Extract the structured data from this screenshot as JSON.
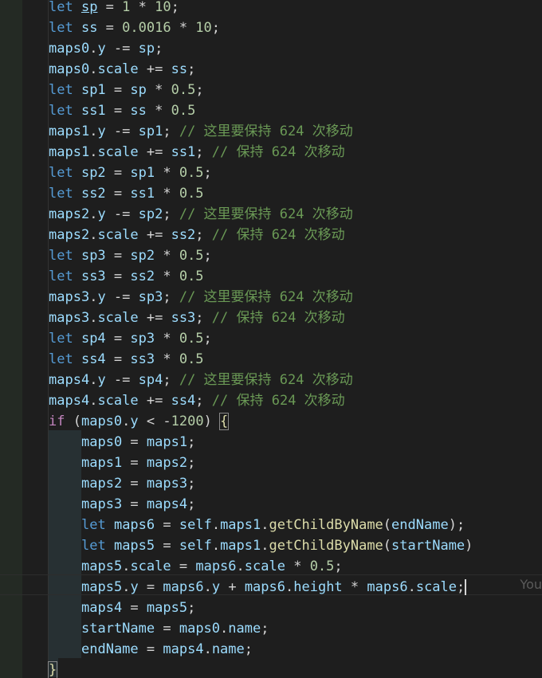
{
  "editor": {
    "ghost_text": "You",
    "lines": [
      {
        "tokens": [
          [
            "kw",
            "let "
          ],
          [
            "id_ul",
            "sp"
          ],
          [
            "op",
            " = "
          ],
          [
            "num",
            "1"
          ],
          [
            "op",
            " * "
          ],
          [
            "num",
            "10"
          ],
          [
            "op",
            ";"
          ]
        ]
      },
      {
        "tokens": [
          [
            "kw",
            "let "
          ],
          [
            "id",
            "ss"
          ],
          [
            "op",
            " = "
          ],
          [
            "num",
            "0.0016"
          ],
          [
            "op",
            " * "
          ],
          [
            "num",
            "10"
          ],
          [
            "op",
            ";"
          ]
        ]
      },
      {
        "tokens": [
          [
            "id",
            "maps0"
          ],
          [
            "op",
            "."
          ],
          [
            "id",
            "y"
          ],
          [
            "op",
            " -= "
          ],
          [
            "id",
            "sp"
          ],
          [
            "op",
            ";"
          ]
        ]
      },
      {
        "tokens": [
          [
            "id",
            "maps0"
          ],
          [
            "op",
            "."
          ],
          [
            "id",
            "scale"
          ],
          [
            "op",
            " += "
          ],
          [
            "id",
            "ss"
          ],
          [
            "op",
            ";"
          ]
        ]
      },
      {
        "tokens": [
          [
            "kw",
            "let "
          ],
          [
            "id",
            "sp1"
          ],
          [
            "op",
            " = "
          ],
          [
            "id",
            "sp"
          ],
          [
            "op",
            " * "
          ],
          [
            "num",
            "0.5"
          ],
          [
            "op",
            ";"
          ]
        ]
      },
      {
        "tokens": [
          [
            "kw",
            "let "
          ],
          [
            "id",
            "ss1"
          ],
          [
            "op",
            " = "
          ],
          [
            "id",
            "ss"
          ],
          [
            "op",
            " * "
          ],
          [
            "num",
            "0.5"
          ]
        ]
      },
      {
        "tokens": [
          [
            "id",
            "maps1"
          ],
          [
            "op",
            "."
          ],
          [
            "id",
            "y"
          ],
          [
            "op",
            " -= "
          ],
          [
            "id",
            "sp1"
          ],
          [
            "op",
            "; "
          ],
          [
            "cm",
            "// 这里要保持 624 次移动"
          ]
        ]
      },
      {
        "tokens": [
          [
            "id",
            "maps1"
          ],
          [
            "op",
            "."
          ],
          [
            "id",
            "scale"
          ],
          [
            "op",
            " += "
          ],
          [
            "id",
            "ss1"
          ],
          [
            "op",
            "; "
          ],
          [
            "cm",
            "// 保持 624 次移动"
          ]
        ]
      },
      {
        "tokens": [
          [
            "kw",
            "let "
          ],
          [
            "id",
            "sp2"
          ],
          [
            "op",
            " = "
          ],
          [
            "id",
            "sp1"
          ],
          [
            "op",
            " * "
          ],
          [
            "num",
            "0.5"
          ],
          [
            "op",
            ";"
          ]
        ]
      },
      {
        "tokens": [
          [
            "kw",
            "let "
          ],
          [
            "id",
            "ss2"
          ],
          [
            "op",
            " = "
          ],
          [
            "id",
            "ss1"
          ],
          [
            "op",
            " * "
          ],
          [
            "num",
            "0.5"
          ]
        ]
      },
      {
        "tokens": [
          [
            "id",
            "maps2"
          ],
          [
            "op",
            "."
          ],
          [
            "id",
            "y"
          ],
          [
            "op",
            " -= "
          ],
          [
            "id",
            "sp2"
          ],
          [
            "op",
            "; "
          ],
          [
            "cm",
            "// 这里要保持 624 次移动"
          ]
        ]
      },
      {
        "tokens": [
          [
            "id",
            "maps2"
          ],
          [
            "op",
            "."
          ],
          [
            "id",
            "scale"
          ],
          [
            "op",
            " += "
          ],
          [
            "id",
            "ss2"
          ],
          [
            "op",
            "; "
          ],
          [
            "cm",
            "// 保持 624 次移动"
          ]
        ]
      },
      {
        "tokens": [
          [
            "kw",
            "let "
          ],
          [
            "id",
            "sp3"
          ],
          [
            "op",
            " = "
          ],
          [
            "id",
            "sp2"
          ],
          [
            "op",
            " * "
          ],
          [
            "num",
            "0.5"
          ],
          [
            "op",
            ";"
          ]
        ]
      },
      {
        "tokens": [
          [
            "kw",
            "let "
          ],
          [
            "id",
            "ss3"
          ],
          [
            "op",
            " = "
          ],
          [
            "id",
            "ss2"
          ],
          [
            "op",
            " * "
          ],
          [
            "num",
            "0.5"
          ]
        ]
      },
      {
        "tokens": [
          [
            "id",
            "maps3"
          ],
          [
            "op",
            "."
          ],
          [
            "id",
            "y"
          ],
          [
            "op",
            " -= "
          ],
          [
            "id",
            "sp3"
          ],
          [
            "op",
            "; "
          ],
          [
            "cm",
            "// 这里要保持 624 次移动"
          ]
        ]
      },
      {
        "tokens": [
          [
            "id",
            "maps3"
          ],
          [
            "op",
            "."
          ],
          [
            "id",
            "scale"
          ],
          [
            "op",
            " += "
          ],
          [
            "id",
            "ss3"
          ],
          [
            "op",
            "; "
          ],
          [
            "cm",
            "// 保持 624 次移动"
          ]
        ]
      },
      {
        "tokens": [
          [
            "kw",
            "let "
          ],
          [
            "id",
            "sp4"
          ],
          [
            "op",
            " = "
          ],
          [
            "id",
            "sp3"
          ],
          [
            "op",
            " * "
          ],
          [
            "num",
            "0.5"
          ],
          [
            "op",
            ";"
          ]
        ]
      },
      {
        "tokens": [
          [
            "kw",
            "let "
          ],
          [
            "id",
            "ss4"
          ],
          [
            "op",
            " = "
          ],
          [
            "id",
            "ss3"
          ],
          [
            "op",
            " * "
          ],
          [
            "num",
            "0.5"
          ]
        ]
      },
      {
        "tokens": [
          [
            "id",
            "maps4"
          ],
          [
            "op",
            "."
          ],
          [
            "id",
            "y"
          ],
          [
            "op",
            " -= "
          ],
          [
            "id",
            "sp4"
          ],
          [
            "op",
            "; "
          ],
          [
            "cm",
            "// 这里要保持 624 次移动"
          ]
        ]
      },
      {
        "tokens": [
          [
            "id",
            "maps4"
          ],
          [
            "op",
            "."
          ],
          [
            "id",
            "scale"
          ],
          [
            "op",
            " += "
          ],
          [
            "id",
            "ss4"
          ],
          [
            "op",
            "; "
          ],
          [
            "cm",
            "// 保持 624 次移动"
          ]
        ]
      },
      {
        "tokens": [
          [
            "ctrl",
            "if "
          ],
          [
            "op",
            "("
          ],
          [
            "id",
            "maps0"
          ],
          [
            "op",
            "."
          ],
          [
            "id",
            "y"
          ],
          [
            "op",
            " < -"
          ],
          [
            "num",
            "1200"
          ],
          [
            "op",
            ") "
          ],
          [
            "brace",
            "{"
          ]
        ]
      },
      {
        "indent": true,
        "tokens": [
          [
            "id",
            "maps0"
          ],
          [
            "op",
            " = "
          ],
          [
            "id",
            "maps1"
          ],
          [
            "op",
            ";"
          ]
        ]
      },
      {
        "indent": true,
        "tokens": [
          [
            "id",
            "maps1"
          ],
          [
            "op",
            " = "
          ],
          [
            "id",
            "maps2"
          ],
          [
            "op",
            ";"
          ]
        ]
      },
      {
        "indent": true,
        "tokens": [
          [
            "id",
            "maps2"
          ],
          [
            "op",
            " = "
          ],
          [
            "id",
            "maps3"
          ],
          [
            "op",
            ";"
          ]
        ]
      },
      {
        "indent": true,
        "tokens": [
          [
            "id",
            "maps3"
          ],
          [
            "op",
            " = "
          ],
          [
            "id",
            "maps4"
          ],
          [
            "op",
            ";"
          ]
        ]
      },
      {
        "indent": true,
        "tokens": [
          [
            "kw",
            "let "
          ],
          [
            "id",
            "maps6"
          ],
          [
            "op",
            " = "
          ],
          [
            "id",
            "self"
          ],
          [
            "op",
            "."
          ],
          [
            "id",
            "maps1"
          ],
          [
            "op",
            "."
          ],
          [
            "fn",
            "getChildByName"
          ],
          [
            "op",
            "("
          ],
          [
            "id",
            "endName"
          ],
          [
            "op",
            ");"
          ]
        ]
      },
      {
        "indent": true,
        "tokens": [
          [
            "kw",
            "let "
          ],
          [
            "id",
            "maps5"
          ],
          [
            "op",
            " = "
          ],
          [
            "id",
            "self"
          ],
          [
            "op",
            "."
          ],
          [
            "id",
            "maps1"
          ],
          [
            "op",
            "."
          ],
          [
            "fn",
            "getChildByName"
          ],
          [
            "op",
            "("
          ],
          [
            "id",
            "startName"
          ],
          [
            "op",
            ")"
          ]
        ]
      },
      {
        "indent": true,
        "tokens": [
          [
            "id",
            "maps5"
          ],
          [
            "op",
            "."
          ],
          [
            "id",
            "scale"
          ],
          [
            "op",
            " = "
          ],
          [
            "id",
            "maps6"
          ],
          [
            "op",
            "."
          ],
          [
            "id",
            "scale"
          ],
          [
            "op",
            " * "
          ],
          [
            "num",
            "0.5"
          ],
          [
            "op",
            ";"
          ]
        ]
      },
      {
        "indent": true,
        "cursor": true,
        "tokens": [
          [
            "id",
            "maps5"
          ],
          [
            "op",
            "."
          ],
          [
            "id",
            "y"
          ],
          [
            "op",
            " = "
          ],
          [
            "id",
            "maps6"
          ],
          [
            "op",
            "."
          ],
          [
            "id",
            "y"
          ],
          [
            "op",
            " + "
          ],
          [
            "id",
            "maps6"
          ],
          [
            "op",
            "."
          ],
          [
            "id",
            "height"
          ],
          [
            "op",
            " * "
          ],
          [
            "id",
            "maps6"
          ],
          [
            "op",
            "."
          ],
          [
            "id",
            "scale"
          ],
          [
            "op",
            ";"
          ]
        ]
      },
      {
        "indent": true,
        "tokens": [
          [
            "id",
            "maps4"
          ],
          [
            "op",
            " = "
          ],
          [
            "id",
            "maps5"
          ],
          [
            "op",
            ";"
          ]
        ]
      },
      {
        "indent": true,
        "tokens": [
          [
            "id",
            "startName"
          ],
          [
            "op",
            " = "
          ],
          [
            "id",
            "maps0"
          ],
          [
            "op",
            "."
          ],
          [
            "id",
            "name"
          ],
          [
            "op",
            ";"
          ]
        ]
      },
      {
        "indent": true,
        "tokens": [
          [
            "id",
            "endName"
          ],
          [
            "op",
            " = "
          ],
          [
            "id",
            "maps4"
          ],
          [
            "op",
            "."
          ],
          [
            "id",
            "name"
          ],
          [
            "op",
            ";"
          ]
        ]
      },
      {
        "tokens": [
          [
            "brace",
            "}"
          ]
        ]
      }
    ]
  }
}
